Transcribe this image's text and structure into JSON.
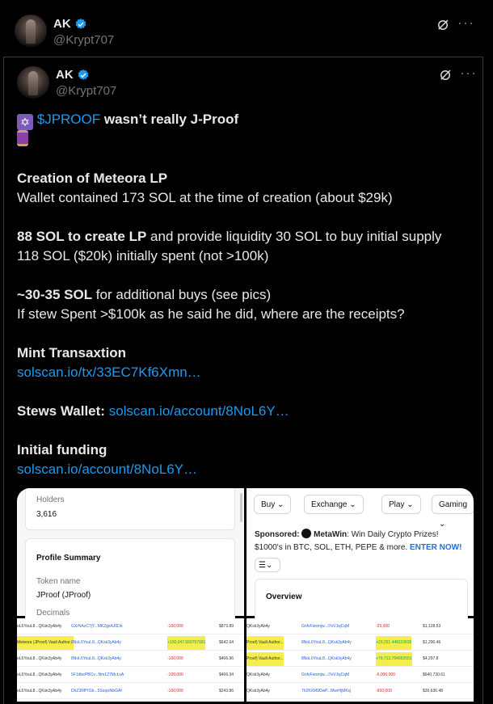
{
  "author": {
    "display_name": "AK",
    "handle": "@Krypt707"
  },
  "tweet": {
    "line1_link": "$JPROOF",
    "line1_text": " wasn’t really J-Proof",
    "section1_title": "Creation of Meteora LP",
    "section1_text": "Wallet contained 173 SOL at the time of creation (about $29k)",
    "section2_bold": "88 SOL to create LP",
    "section2_text": " and provide liquidity 30 SOL to buy initial supply",
    "section2_line2": "118 SOL ($20k) initially spent (not >100k)",
    "section3_bold": "~30-35 SOL",
    "section3_text": " for additional buys (see pics)",
    "section3_line2": "If stew Spent >$100k as he said he did, where are the receipts?",
    "mint_title": "Mint Transaxtion",
    "mint_link": "solscan.io/tx/33EC7Kf6Xmn…",
    "wallet_label": "Stews Wallet:",
    "wallet_link": "solscan.io/account/8NoL6Y…",
    "funding_title": "Initial funding",
    "funding_link": "solscan.io/account/8NoL6Y…"
  },
  "icons": [
    "verified-badge-icon",
    "grok-icon",
    "more-icon",
    "star-of-david-emoji",
    "spool-of-thread-emoji",
    "chevron-down-icon",
    "list-icon"
  ],
  "colors": {
    "link": "#1d9bf0",
    "verified": "#1d9bf0",
    "background": "#000000"
  },
  "media": {
    "img1": {
      "holders_label": "Holders",
      "holders_value": "3,616",
      "profile_summary": "Profile Summary",
      "token_name_label": "Token name",
      "token_name_value": "JProof (JProof)",
      "decimals_label": "Decimals"
    },
    "img2": {
      "tabs": [
        "Buy",
        "Exchange",
        "Play",
        "Gaming"
      ],
      "sponsored_label": "Sponsored:",
      "sponsor_name": "MetaWin",
      "sponsor_text": ": Win Daily Crypto Prizes!",
      "sponsor_line2": "$1000's in BTC, SOL, ETH, PEPE & more.",
      "sponsor_cta": "ENTER NOW!",
      "overview": "Overview"
    },
    "img3_rows": [
      {
        "from": "oL6YouL8...QKsk3yAb4y",
        "to": "GXrNAzC7jY...MKZgsAJ6Db",
        "amount": "-100,000",
        "value": "$873.89",
        "hl": false
      },
      {
        "from": "Meteora (JProof) Vault Author...",
        "to": "8NoL6YouL8...QKsk3yAb4y",
        "amount": "+100,047.560757681",
        "value": "$642.64",
        "hl": true
      },
      {
        "from": "oL6YouL8...QKsk3yAb4y",
        "to": "8NoL6YouL8...QKsk3yAb4y",
        "amount": "-100,000",
        "value": "$406.96",
        "hl": false
      },
      {
        "from": "oL6YouL8...QKsk3yAb4y",
        "to": "5F1dbePBCv...Nm1Z7McLvA",
        "amount": "-100,000",
        "value": "$406.34",
        "hl": false
      },
      {
        "from": "oL6YouL8...QKsk3yAb4y",
        "to": "DhZ3RffYGb...5SsqwNbGAf",
        "amount": "-100,000",
        "value": "$243.86",
        "hl": false
      }
    ],
    "img4_rows": [
      {
        "from": "QKsk3yAb4y",
        "to": "GnfvFwsmjw...i7eVJsjCqM",
        "amount": "-25,000",
        "value": "$1,128.53",
        "hl": false
      },
      {
        "from": "Proof) Vault Author...",
        "to": "8NoL6YouL8...QKsk3yAb4y",
        "amount": "+29,251.448110936",
        "value": "$1,290.46",
        "hl": true
      },
      {
        "from": "Proof) Vault Author...",
        "to": "8NoL6YouL8...QKsk3yAb4y",
        "amount": "+79,713.794062551",
        "value": "$4,297.8",
        "hl": true
      },
      {
        "from": "QKsk3yAb4y",
        "to": "GnfvFwsmjw...i7eVJsjCqM",
        "amount": "-6,000,000",
        "value": "$640,730.61",
        "hl": false
      },
      {
        "from": "QKsk3yAb4y",
        "to": "7h2KXM9DwP...MwrHjMKcj",
        "amount": "-650,000",
        "value": "$30,636.48",
        "hl": false
      }
    ]
  }
}
